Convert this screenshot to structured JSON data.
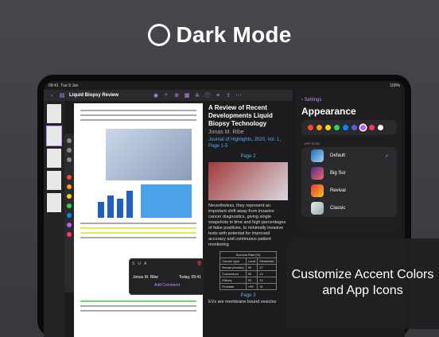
{
  "headline": {
    "title": "Dark Mode"
  },
  "status": {
    "time": "09:41",
    "date": "Tue 9 Jan",
    "battery": "100%"
  },
  "toolbar": {
    "document_title": "Liquid Biopsy Review"
  },
  "reader": {
    "title": "A Review of Recent Developments Liquid Biopsy Technology",
    "author": "Jonas M. Ribe",
    "journal": "Journal of Highlights, 2020, Vol. 1, Page 1-5",
    "page2": "Page 2",
    "page3": "Page 3",
    "body": "Nevertheless, they represent an important shift away from invasive cancer diagnostics, giving single snapshots in time and high percentages of false positives, to minimally invasive tests with potential for improved accuracy and continuous patient monitoring",
    "footer": "EVs are membrane bound vesicles",
    "table": {
      "header": [
        "Cancer type",
        "Local",
        "Metastatic"
      ],
      "caption": "Survival Rate [%]",
      "rows": [
        [
          "Breast (female)",
          "99",
          "27"
        ],
        [
          "Colorectum",
          "90",
          "14"
        ],
        [
          "Kidney",
          "93",
          "12"
        ],
        [
          "Prostate",
          ">99",
          "31"
        ]
      ]
    }
  },
  "comment": {
    "author": "Jonas M. Ribe",
    "time": "Today, 09:41",
    "action": "Add Comment"
  },
  "settings": {
    "back": "Settings",
    "title": "Appearance",
    "app_icon_label": "APP ICON",
    "accent_colors": [
      "#ff453a",
      "#ff9f0a",
      "#ffd60a",
      "#30d158",
      "#0a84ff",
      "#5e5ce6",
      "#bf5af2",
      "#ff375f",
      "#ffffff"
    ],
    "icons": [
      {
        "name": "Default",
        "selected": true
      },
      {
        "name": "Big Sur",
        "selected": false
      },
      {
        "name": "Revival",
        "selected": false
      },
      {
        "name": "Classic",
        "selected": false
      }
    ]
  },
  "callout": {
    "text": "Customize Accent Colors and App Icons"
  }
}
